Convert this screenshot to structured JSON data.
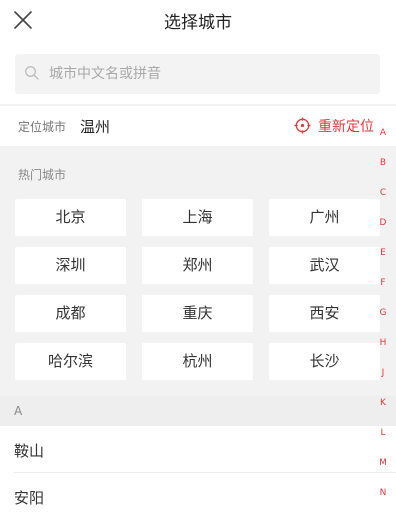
{
  "header": {
    "title": "选择城市",
    "close_icon": "close-icon"
  },
  "search": {
    "placeholder": "城市中文名或拼音",
    "value": "",
    "icon": "search-icon"
  },
  "location": {
    "label": "定位城市",
    "city": "温州",
    "relocate_label": "重新定位",
    "relocate_icon": "crosshair-icon"
  },
  "hot": {
    "label": "热门城市",
    "cities": [
      "北京",
      "上海",
      "广州",
      "深圳",
      "郑州",
      "武汉",
      "成都",
      "重庆",
      "西安",
      "哈尔滨",
      "杭州",
      "长沙"
    ]
  },
  "sections": [
    {
      "letter": "A",
      "cities": [
        "鞍山",
        "安阳"
      ]
    }
  ],
  "index": [
    "A",
    "B",
    "C",
    "D",
    "E",
    "F",
    "G",
    "H",
    "J",
    "K",
    "L",
    "M",
    "N"
  ],
  "colors": {
    "accent": "#e0393e",
    "background_gray": "#f2f2f2"
  }
}
